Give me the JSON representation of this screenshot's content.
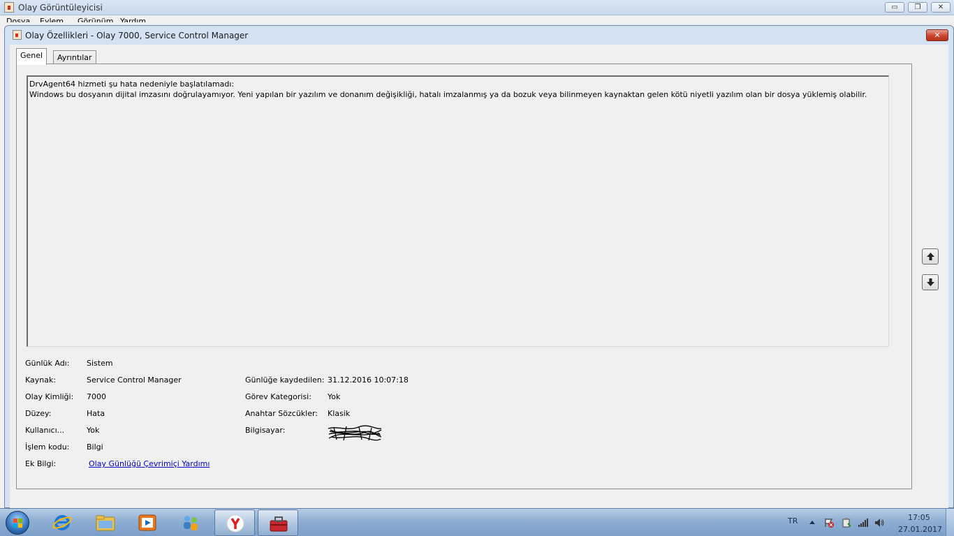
{
  "main_window": {
    "title": "Olay Görüntüleyicisi",
    "menu": [
      "Dosya",
      "Eylem",
      "Görünüm",
      "Yardım"
    ],
    "minimize_label": "▭",
    "maximize_label": "❐",
    "close_label": "✕"
  },
  "dialog": {
    "title": "Olay Özellikleri - Olay 7000, Service Control Manager",
    "close_label": "✕",
    "tabs": [
      {
        "label": "Genel",
        "active": true
      },
      {
        "label": "Ayrıntılar",
        "active": false
      }
    ],
    "description_line1": "DrvAgent64 hizmeti şu hata nedeniyle başlatılamadı:",
    "description_line2": "Windows bu dosyanın dijital imzasını doğrulayamıyor. Yeni yapılan bir yazılım ve donanım değişikliği, hatalı imzalanmış ya da bozuk veya bilinmeyen kaynaktan gelen kötü niyetli yazılım olan bir dosya yüklemiş olabilir.",
    "fields": {
      "log_name_label": "Günlük Adı:",
      "log_name_value": "Sistem",
      "source_label": "Kaynak:",
      "source_value": "Service Control Manager",
      "logged_label": "Günlüğe kaydedilen:",
      "logged_value": "31.12.2016 10:07:18",
      "event_id_label": "Olay Kimliği:",
      "event_id_value": "7000",
      "task_category_label": "Görev Kategorisi:",
      "task_category_value": "Yok",
      "level_label": "Düzey:",
      "level_value": "Hata",
      "keywords_label": "Anahtar Sözcükler:",
      "keywords_value": "Klasik",
      "user_label": "Kullanıcı...",
      "user_value": "Yok",
      "computer_label": "Bilgisayar:",
      "opcode_label": "İşlem kodu:",
      "opcode_value": "Bilgi",
      "more_info_label": "Ek Bilgi:",
      "more_info_link": "Olay Günlüğü Çevrimiçi Yardımı"
    }
  },
  "taskbar": {
    "apps": [
      "internet-explorer",
      "windows-explorer",
      "media-player",
      "network-people",
      "yandex-browser",
      "event-viewer-toolbox"
    ],
    "language": "TR",
    "time": "17:05",
    "date": "27.01.2017"
  },
  "colors": {
    "link": "#0000cc",
    "close_red": "#c9442e",
    "taskbar_blue": "#8eaed3"
  }
}
